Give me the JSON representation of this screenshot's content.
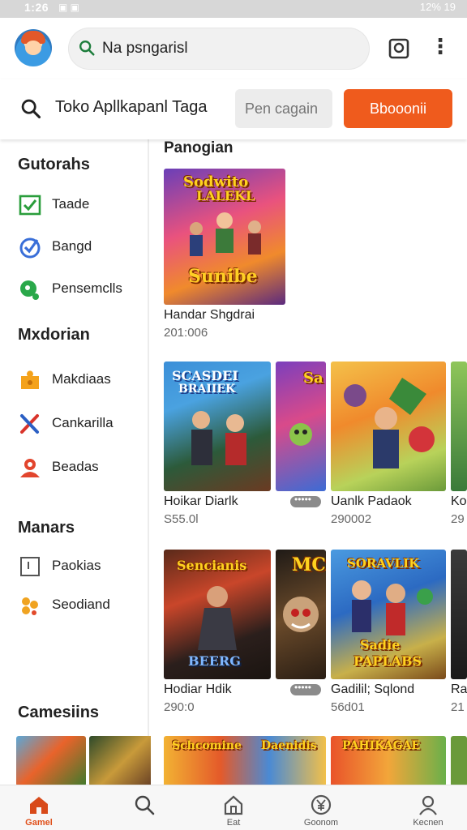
{
  "status_bar": {
    "time": "1:26",
    "right": "12% 19"
  },
  "header": {
    "search_text": "Na psngarisl",
    "avatar_icon": "avatar-icon",
    "menu_icon": "more-vert-icon",
    "square_icon": "screen-icon"
  },
  "search_row": {
    "label": "Toko Apllkapanl Taga",
    "input_placeholder": "Pen cagain",
    "button_label": "Bbooonii",
    "accent": "#ef5b1d"
  },
  "sidebar": {
    "sections": [
      {
        "title": "Gutorahs",
        "items": [
          {
            "label": "Taade",
            "icon": "checkbox-icon"
          },
          {
            "label": "Bangd",
            "icon": "check-circle-icon"
          },
          {
            "label": "Pensemclls",
            "icon": "green-dot-icon"
          }
        ]
      },
      {
        "title": "Mxdorian",
        "items": [
          {
            "label": "Makdiaas",
            "icon": "puzzle-icon"
          },
          {
            "label": "Cankarilla",
            "icon": "swords-icon"
          },
          {
            "label": "Beadas",
            "icon": "person-icon"
          }
        ]
      },
      {
        "title": "Manars",
        "items": [
          {
            "label": "Paokias",
            "icon": "frame-icon"
          },
          {
            "label": "Seodiand",
            "icon": "flower-icon"
          }
        ]
      },
      {
        "title": "Camesiins",
        "items": []
      }
    ]
  },
  "main": {
    "heading": "Panogian",
    "featured": {
      "title": "Handar Shgdrai",
      "sub": "201:006",
      "art_text": [
        "Sodwito",
        "LALEKL",
        "Sunibe"
      ]
    },
    "row1": [
      {
        "title": "Hoikar Diarlk",
        "sub": "S55.0l",
        "art_text": [
          "SCASDEI",
          "BRAIIEK"
        ]
      },
      {
        "title": "",
        "sub": "",
        "art_text": [
          "Sa"
        ]
      },
      {
        "title": "Uanlk Padaok",
        "sub": "290002",
        "art_text": []
      },
      {
        "title": "Ko",
        "sub": "29",
        "art_text": []
      }
    ],
    "row2": [
      {
        "title": "Hodiar Hdik",
        "sub": "290:0",
        "art_text": [
          "Sencianis",
          "BEERG"
        ]
      },
      {
        "title": "",
        "sub": "",
        "art_text": [
          "MCA"
        ]
      },
      {
        "title": "Gadilil; Sqlond",
        "sub": "56d01",
        "art_text": [
          "SORAVLIK",
          "Sadie",
          "PAPLABS"
        ]
      },
      {
        "title": "Ra",
        "sub": "21",
        "art_text": []
      }
    ],
    "row3_art_text": [
      "Schcomine",
      "Daenidis",
      "PAHIKAGAE"
    ]
  },
  "bottom_nav": [
    {
      "label": "Gamel",
      "icon": "home-icon",
      "active": true
    },
    {
      "label": "",
      "icon": "search-icon",
      "active": false
    },
    {
      "label": "Eat",
      "icon": "house-icon",
      "active": false
    },
    {
      "label": "Goonom",
      "icon": "currency-icon",
      "active": false
    },
    {
      "label": "Kecnen",
      "icon": "account-icon",
      "active": false
    }
  ]
}
